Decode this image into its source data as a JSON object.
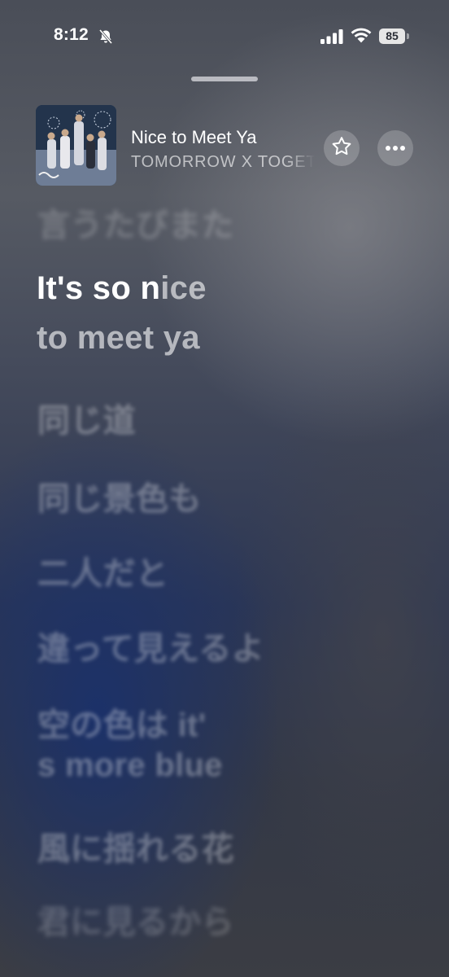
{
  "status_bar": {
    "time": "8:12",
    "battery": "85"
  },
  "now_playing": {
    "title": "Nice to Meet Ya",
    "artist": "TOMORROW X TOGETHER"
  },
  "lyrics": {
    "previous": "言うたびまた",
    "active": {
      "line1_sung": "It's so n",
      "line1_unsung": "ice",
      "line2": "to meet ya"
    },
    "upcoming": [
      "同じ道",
      "同じ景色も",
      "二人だと",
      "違って見えるよ",
      "空の色は it'",
      "s more blue",
      "風に揺れる花",
      "君に見るから"
    ]
  },
  "icons": {
    "bell": "bell-slash-icon",
    "signal": "cellular-signal-icon",
    "wifi": "wifi-icon",
    "star": "star-icon",
    "more": "ellipsis-icon"
  },
  "colors": {
    "lyric_active": "#ffffff",
    "lyric_dim": "rgba(255,255,255,0.6)"
  }
}
